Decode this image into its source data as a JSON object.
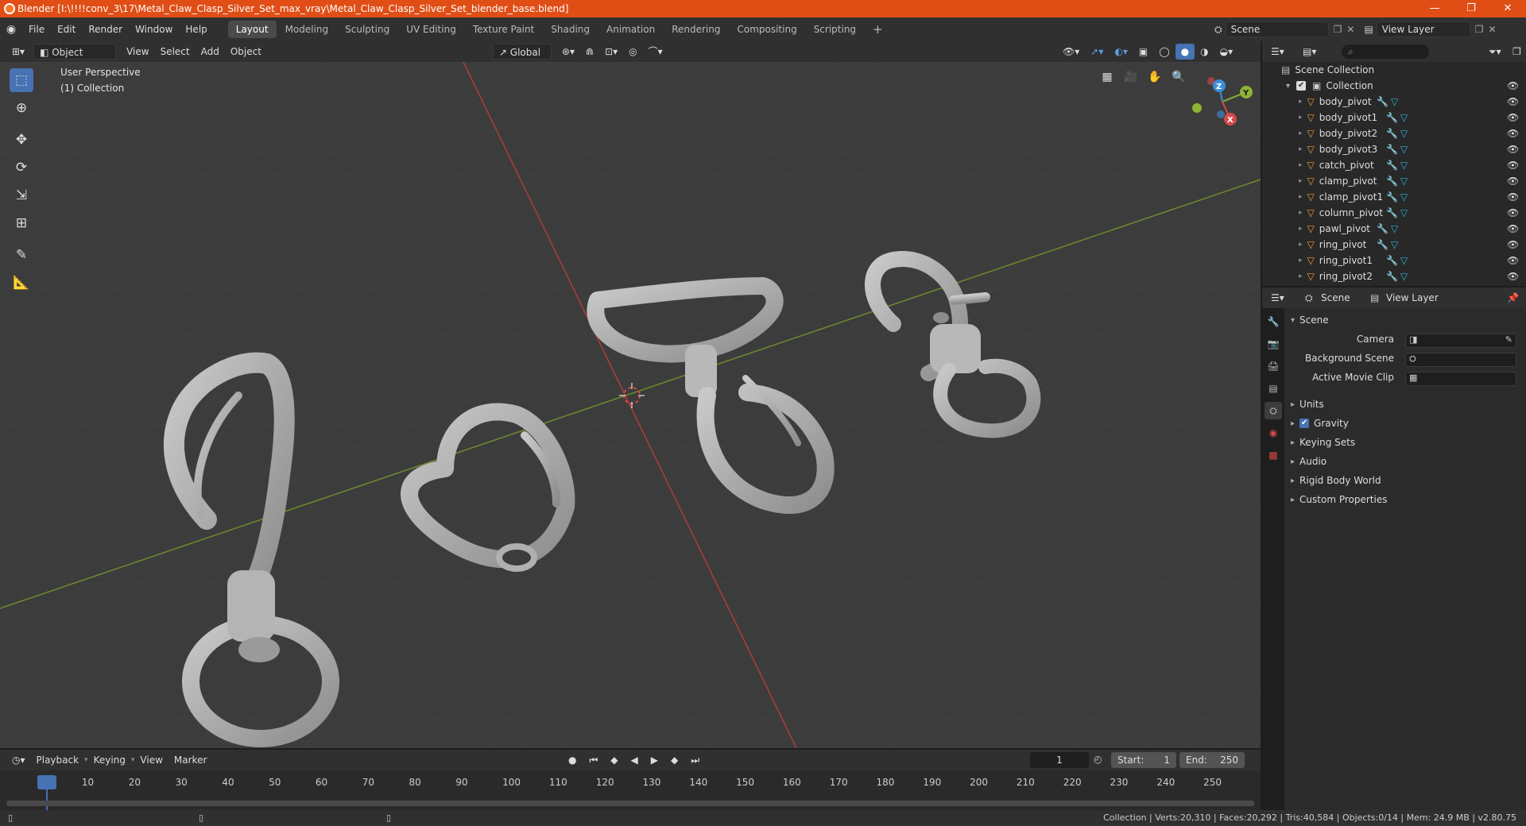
{
  "title": "Blender [I:\\!!!!conv_3\\17\\Metal_Claw_Clasp_Silver_Set_max_vray\\Metal_Claw_Clasp_Silver_Set_blender_base.blend]",
  "window_controls": {
    "minimize": "—",
    "maximize": "❐",
    "close": "✕"
  },
  "menu": [
    "File",
    "Edit",
    "Render",
    "Window",
    "Help"
  ],
  "workspaces": [
    "Layout",
    "Modeling",
    "Sculpting",
    "UV Editing",
    "Texture Paint",
    "Shading",
    "Animation",
    "Rendering",
    "Compositing",
    "Scripting"
  ],
  "active_workspace": "Layout",
  "scene_field": "Scene",
  "view_layer_field": "View Layer",
  "viewport_header": {
    "mode": "Object Mode",
    "menus": [
      "View",
      "Select",
      "Add",
      "Object"
    ],
    "transform_orientation": "Global"
  },
  "viewport": {
    "perspective": "User Perspective",
    "collection": "(1) Collection",
    "gizmo": {
      "x": "X",
      "y": "Y",
      "z": "Z"
    }
  },
  "outliner": {
    "root": "Scene Collection",
    "collection": "Collection",
    "items": [
      "body_pivot",
      "body_pivot1",
      "body_pivot2",
      "body_pivot3",
      "catch_pivot",
      "clamp_pivot",
      "clamp_pivot1",
      "column_pivot",
      "pawl_pivot",
      "ring_pivot",
      "ring_pivot1",
      "ring_pivot2"
    ]
  },
  "properties": {
    "header_scene": "Scene",
    "header_view_layer": "View Layer",
    "panel": "Scene",
    "camera_label": "Camera",
    "background_scene_label": "Background Scene",
    "active_movie_clip_label": "Active Movie Clip",
    "sections": [
      "Units",
      "Gravity",
      "Keying Sets",
      "Audio",
      "Rigid Body World",
      "Custom Properties"
    ]
  },
  "timeline": {
    "menus": [
      "Playback",
      "Keying",
      "View",
      "Marker"
    ],
    "current_frame": "1",
    "start_label": "Start:",
    "start": "1",
    "end_label": "End:",
    "end": "250",
    "ticks": [
      "1",
      "10",
      "20",
      "30",
      "40",
      "50",
      "60",
      "70",
      "80",
      "90",
      "100",
      "110",
      "120",
      "130",
      "140",
      "150",
      "160",
      "170",
      "180",
      "190",
      "200",
      "210",
      "220",
      "230",
      "240",
      "250"
    ]
  },
  "statusbar": "Collection | Verts:20,310 | Faces:20,292 | Tris:40,584 | Objects:0/14 | Mem: 24.9 MB | v2.80.75",
  "colors": {
    "title_bar": "#e04e16",
    "accent": "#4772b3",
    "x_axis": "#d44a4a",
    "y_axis": "#8cb435",
    "z_axis": "#3a8fd9",
    "mesh_icon": "#f09a3a",
    "modifier_icon": "#2bb3d9"
  }
}
